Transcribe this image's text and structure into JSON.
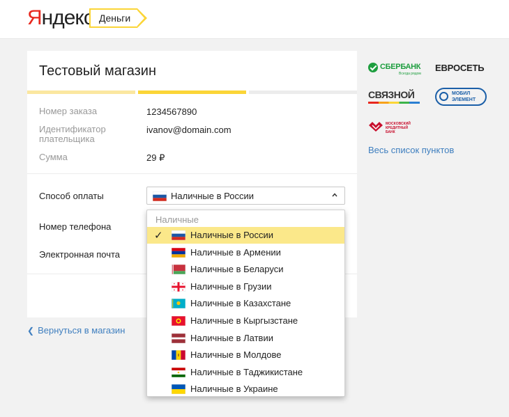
{
  "header": {
    "logo_first": "Я",
    "logo_rest": "ндекс",
    "money_label": "Деньги"
  },
  "card": {
    "title": "Тестовый магазин",
    "progress_steps": 3,
    "progress_active_step": 2,
    "order_label": "Номер заказа",
    "order_value": "1234567890",
    "payer_label": "Идентификатор плательщика",
    "payer_value": "ivanov@domain.com",
    "sum_label": "Сумма",
    "sum_value": "29 ₽",
    "payment_label": "Способ оплаты",
    "payment_selected": "Наличные в России",
    "phone_label": "Номер телефона",
    "email_label": "Электронная почта"
  },
  "back_link": "Вернуться в магазин",
  "brands": {
    "sber": "СБЕРБАНК",
    "sber_sub": "Всегда рядом",
    "euroset": "ЕВРОСЕТЬ",
    "svyaznoy": "СВЯЗНОЙ",
    "mobil_line1": "МОБИЛ",
    "mobil_line2": "ЭЛЕМЕНТ",
    "mkb_line1": "МОСКОВСКИЙ",
    "mkb_line2": "КРЕДИТНЫЙ",
    "mkb_line3": "БАНК",
    "points_link": "Весь список пунктов"
  },
  "dropdown": {
    "group_label": "Наличные",
    "check": "✓",
    "items": [
      {
        "label": "Наличные в России",
        "flag": "ru",
        "selected": true
      },
      {
        "label": "Наличные в Армении",
        "flag": "am",
        "selected": false
      },
      {
        "label": "Наличные в Беларуси",
        "flag": "by",
        "selected": false
      },
      {
        "label": "Наличные в Грузии",
        "flag": "ge",
        "selected": false
      },
      {
        "label": "Наличные в Казахстане",
        "flag": "kz",
        "selected": false
      },
      {
        "label": "Наличные в Кыргызстане",
        "flag": "kg",
        "selected": false
      },
      {
        "label": "Наличные в Латвии",
        "flag": "lv",
        "selected": false
      },
      {
        "label": "Наличные в Молдове",
        "flag": "md",
        "selected": false
      },
      {
        "label": "Наличные в Таджикистане",
        "flag": "tj",
        "selected": false
      },
      {
        "label": "Наличные в Украине",
        "flag": "ua",
        "selected": false
      }
    ]
  },
  "colors": {
    "accent_yellow": "#fbd537",
    "link_blue": "#3f7fbf",
    "selected_row": "#fbe88a"
  }
}
